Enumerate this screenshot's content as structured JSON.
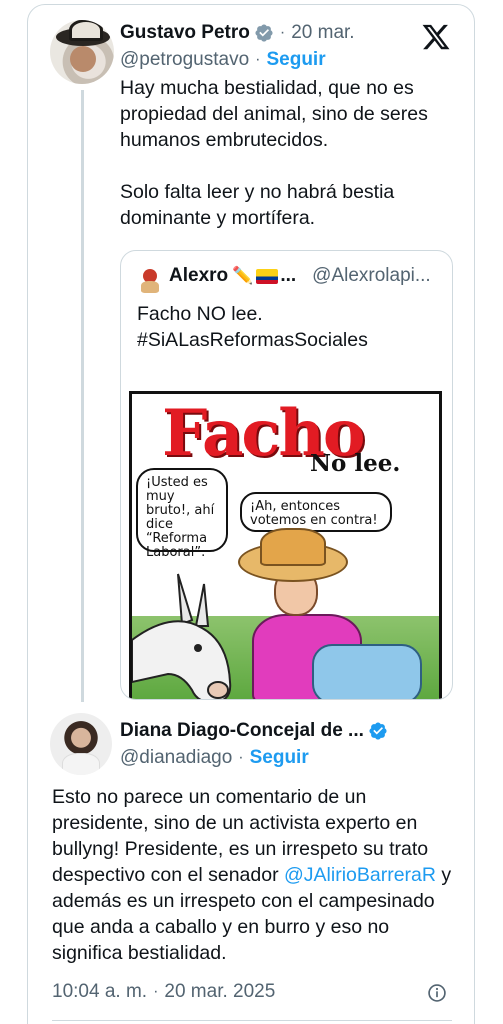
{
  "tweet": {
    "author": {
      "name": "Gustavo Petro",
      "handle": "@petrogustavo",
      "date": "20 mar.",
      "follow_label": "Seguir"
    },
    "text_p1": "Hay mucha bestialidad, que no es propiedad del animal, sino de seres humanos embrutecidos.",
    "text_p2": "Solo falta leer y no habrá bestia dominante y mortífera."
  },
  "quote": {
    "name": "Alexro",
    "name_emoji": "✏️",
    "ellipsis": "...",
    "handle": "@Alexrolapi...",
    "line1": "Facho NO lee.",
    "line2": "#SiALasReformasSociales",
    "comic": {
      "title": "Facho",
      "subtitle": "No lee.",
      "bubble_left": "¡Usted es muy bruto!, ahí dice “Reforma Laboral”.",
      "bubble_right": "¡Ah, entonces votemos en contra!"
    }
  },
  "reply": {
    "author": {
      "name": "Diana Diago-Concejal de ...",
      "handle": "@dianadiago",
      "follow_label": "Seguir"
    },
    "text_before": "Esto no parece un comentario de un presidente, sino de un activista experto en bullyng! Presidente, es un irrespeto su trato despectivo con el senador ",
    "mention": "@JAlirioBarreraR",
    "text_after": " y además es un irrespeto con el campesinado que anda a caballo y en burro y eso no significa bestialidad.",
    "time": "10:04 a. m.",
    "date": "20 mar. 2025"
  },
  "dot": "·",
  "colors": {
    "accent": "#1d9bf0",
    "muted": "#536471",
    "text": "#0f1419",
    "border": "#cfd9de"
  },
  "icons": {
    "verified": "verified-badge-icon",
    "x_logo": "x-logo-icon",
    "info": "info-icon"
  }
}
